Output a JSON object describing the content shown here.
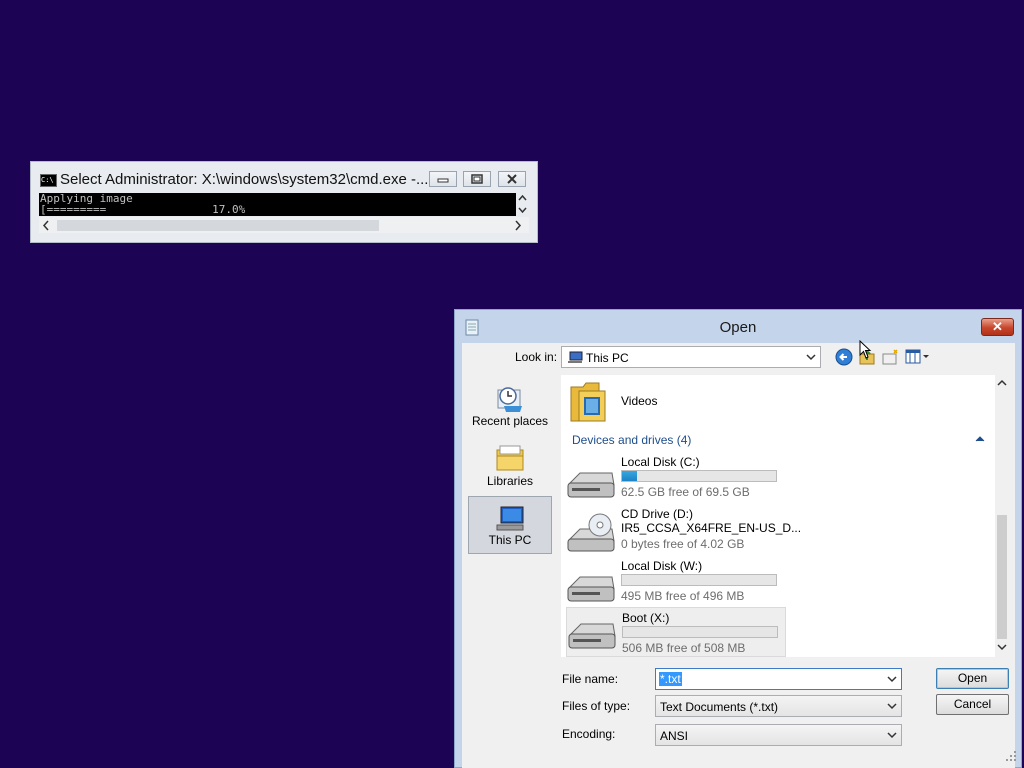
{
  "cmd_window": {
    "title": "Select Administrator: X:\\windows\\system32\\cmd.exe -...",
    "console_line1": "Applying image",
    "console_line2": "[=========                17.0%"
  },
  "open_dialog": {
    "title": "Open",
    "look_in_label": "Look in:",
    "look_in_value": "This PC",
    "nav": {
      "recent": "Recent places",
      "libraries": "Libraries",
      "this_pc": "This PC"
    },
    "folders": [
      {
        "name": "Videos",
        "icon": "videos-folder-icon"
      }
    ],
    "group_header": "Devices and drives (4)",
    "drives": [
      {
        "name": "Local Disk (C:)",
        "subtitle": "",
        "used_fraction": 0.1,
        "free_text": "62.5 GB free of 69.5 GB",
        "icon": "hard-drive-icon"
      },
      {
        "name": "CD Drive (D:)",
        "subtitle": "IR5_CCSA_X64FRE_EN-US_D...",
        "used_fraction": null,
        "free_text": "0 bytes free of 4.02 GB",
        "icon": "cd-drive-icon"
      },
      {
        "name": "Local Disk (W:)",
        "subtitle": "",
        "used_fraction": 0.0,
        "free_text": "495 MB free of 496 MB",
        "icon": "hard-drive-icon"
      },
      {
        "name": "Boot (X:)",
        "subtitle": "",
        "used_fraction": 0.0,
        "free_text": "506 MB free of 508 MB",
        "icon": "hard-drive-icon"
      }
    ],
    "file_name_label": "File name:",
    "file_name_value": "*.txt",
    "files_of_type_label": "Files of type:",
    "files_of_type_value": "Text Documents (*.txt)",
    "encoding_label": "Encoding:",
    "encoding_value": "ANSI",
    "open_button": "Open",
    "cancel_button": "Cancel"
  },
  "colors": {
    "desktop": "#1c0354",
    "progress_fill": "#1e82c6",
    "group_header": "#1e4e8c",
    "close_button": "#c8452c"
  }
}
